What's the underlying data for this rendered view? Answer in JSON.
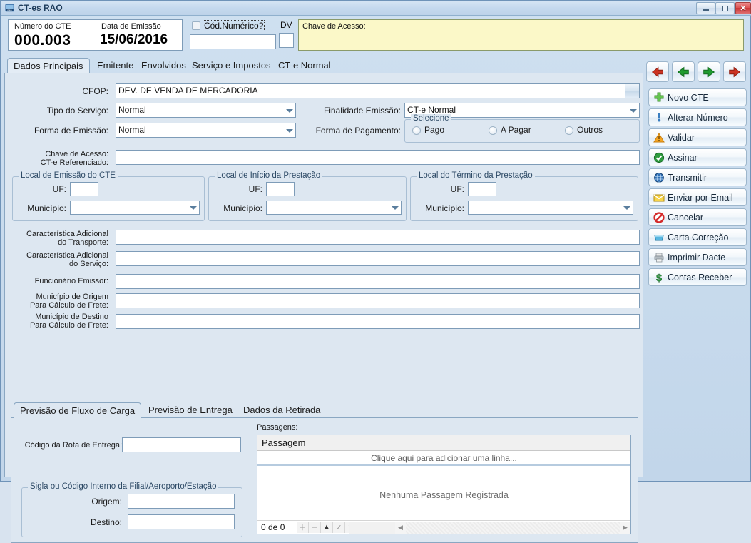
{
  "window": {
    "title": "CT-es RAO",
    "icon": "app-icon",
    "minimize": "minimize",
    "maximize": "maximize",
    "close": "close"
  },
  "header": {
    "cte_number_label": "Número do CTE",
    "cte_number_value": "000.003",
    "issue_date_label": "Data de Emissão",
    "issue_date_value": "15/06/2016",
    "cod_numerico_label": "Cód.Numérico?",
    "cod_numerico_value": "",
    "dv_label": "DV",
    "dv_value": "",
    "chave_acesso_label": "Chave de Acesso:",
    "chave_acesso_value": ""
  },
  "main_tabs": [
    {
      "label": "Dados Principais",
      "active": true
    },
    {
      "label": "Emitente",
      "active": false
    },
    {
      "label": "Envolvidos",
      "active": false
    },
    {
      "label": "Serviço e Impostos",
      "active": false
    },
    {
      "label": "CT-e Normal",
      "active": false
    }
  ],
  "form": {
    "cfop_label": "CFOP:",
    "cfop_value": "DEV. DE VENDA DE MERCADORIA",
    "tipo_servico_label": "Tipo do Serviço:",
    "tipo_servico_value": "Normal",
    "finalidade_label": "Finalidade Emissão:",
    "finalidade_value": "CT-e Normal",
    "forma_emissao_label": "Forma de Emissão:",
    "forma_emissao_value": "Normal",
    "forma_pagamento_label": "Forma de Pagamento:",
    "selecione_label": "Selecione",
    "pagamento_options": [
      "Pago",
      "A Pagar",
      "Outros"
    ],
    "chave_ref_label_l1": "Chave de Acesso:",
    "chave_ref_label_l2": "CT-e Referenciado:",
    "chave_ref_value": "",
    "uf_label": "UF:",
    "municipio_label": "Município:",
    "groups": [
      {
        "title": "Local de Emissão do CTE",
        "uf": "",
        "municipio": ""
      },
      {
        "title": "Local de Início da Prestação",
        "uf": "",
        "municipio": ""
      },
      {
        "title": "Local do Término da Prestação",
        "uf": "",
        "municipio": ""
      }
    ],
    "carac_transporte_l1": "Característica Adicional",
    "carac_transporte_l2": "do Transporte:",
    "carac_transporte_value": "",
    "carac_servico_l1": "Característica Adicional",
    "carac_servico_l2": "do Serviço:",
    "carac_servico_value": "",
    "funcionario_label": "Funcionário Emissor:",
    "funcionario_value": "",
    "mun_origem_l1": "Município de Origem",
    "mun_origem_l2": "Para Cálculo de Frete:",
    "mun_origem_value": "",
    "mun_destino_l1": "Município de Destino",
    "mun_destino_l2": "Para Cálculo de Frete:",
    "mun_destino_value": ""
  },
  "bottom_tabs": [
    {
      "label": "Previsão de Fluxo de Carga",
      "active": true
    },
    {
      "label": "Previsão de Entrega",
      "active": false
    },
    {
      "label": "Dados da Retirada",
      "active": false
    }
  ],
  "bottom_panel": {
    "rota_label": "Código da Rota de Entrega:",
    "rota_value": "",
    "sigla_group_title": "Sigla ou Código Interno da Filial/Aeroporto/Estação",
    "origem_label": "Origem:",
    "origem_value": "",
    "destino_label": "Destino:",
    "destino_value": "",
    "passagens_label": "Passagens:",
    "grid_column": "Passagem",
    "grid_add_row": "Clique aqui para adicionar uma linha...",
    "grid_empty": "Nenhuma Passagem Registrada",
    "grid_count": "0 de 0",
    "nav_buttons": [
      "add",
      "remove",
      "up",
      "confirm",
      "cancel"
    ]
  },
  "sidebar": {
    "nav": [
      {
        "name": "first-record",
        "dir": "left",
        "color": "#cc3322"
      },
      {
        "name": "prev-record",
        "dir": "left",
        "color": "#1f9b2f"
      },
      {
        "name": "next-record",
        "dir": "right",
        "color": "#1f9b2f"
      },
      {
        "name": "last-record",
        "dir": "right",
        "color": "#cc3322"
      }
    ],
    "buttons": [
      {
        "label": "Novo CTE",
        "icon": "plus-icon",
        "color": "#4caf3f"
      },
      {
        "label": "Alterar Número",
        "icon": "pin-icon",
        "color": "#2f6fb5"
      },
      {
        "label": "Validar",
        "icon": "warning-icon",
        "color": "#f5a623"
      },
      {
        "label": "Assinar",
        "icon": "check-circle-icon",
        "color": "#2e9b3f"
      },
      {
        "label": "Transmitir",
        "icon": "globe-icon",
        "color": "#2f6fb5"
      },
      {
        "label": "Enviar por Email",
        "icon": "envelope-icon",
        "color": "#f0c020"
      },
      {
        "label": "Cancelar",
        "icon": "prohibited-icon",
        "color": "#d42a2a"
      },
      {
        "label": "Carta Correção",
        "icon": "document-icon",
        "color": "#4aa8d8"
      },
      {
        "label": "Imprimir Dacte",
        "icon": "printer-icon",
        "color": "#9aa5ad"
      },
      {
        "label": "Contas Receber",
        "icon": "dollar-icon",
        "color": "#2e9b3f"
      }
    ]
  },
  "colors": {
    "window_bg": "#cfe0f0",
    "panel_bg": "#dde7f1",
    "accent_yellow": "#fbf8c8",
    "border": "#8aa7c2",
    "close_red": "#c93434"
  }
}
